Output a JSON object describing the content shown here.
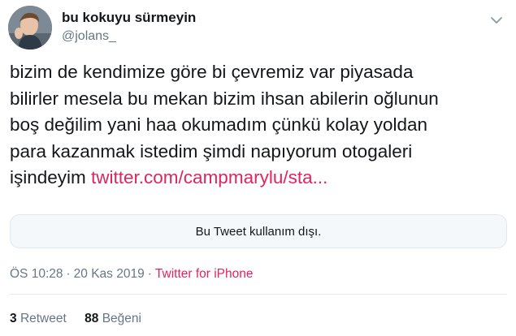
{
  "author": {
    "display_name": "bu kokuyu sürmeyin",
    "handle": "@jolans_",
    "avatar_icon": "user-avatar"
  },
  "header": {
    "more_icon": "chevron-down-icon"
  },
  "tweet": {
    "lines": [
      "bizim de kendimize göre bi çevremiz var piyasada",
      "bilirler mesela bu mekan bizim ihsan abilerin oğlunun",
      "boş değilim yani haa okumadım çünkü kolay yoldan",
      "para kazanmak istedim şimdi napıyorum otogaleri"
    ],
    "last_line_prefix": "işindeyim ",
    "link_text": "twitter.com/campmarylu/sta..."
  },
  "unavailable_card": {
    "text": "Bu Tweet kullanım dışı."
  },
  "meta": {
    "time": "ÖS 10:28",
    "separator": "·",
    "date": "20 Kas 2019",
    "source": "Twitter for iPhone"
  },
  "stats": {
    "retweet_count": "3",
    "retweet_label": "Retweet",
    "like_count": "88",
    "like_label": "Beğeni"
  },
  "colors": {
    "text": "#14171a",
    "secondary": "#657786",
    "link": "#e0245e",
    "border": "#e1e8ed"
  }
}
